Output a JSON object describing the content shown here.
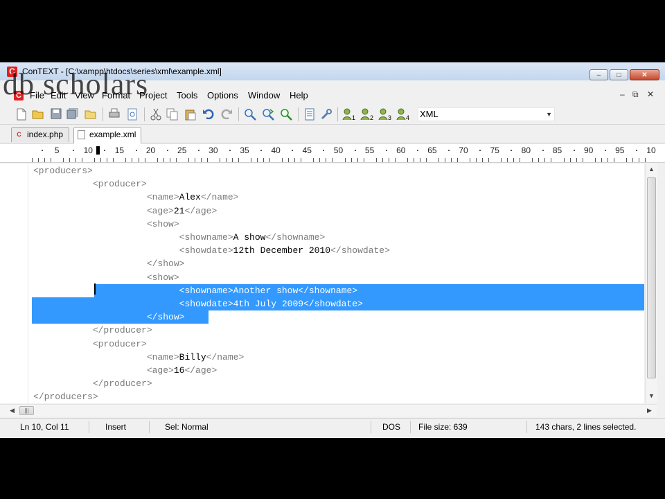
{
  "window": {
    "title": "ConTEXT - [C:\\xampp\\htdocs\\series\\xml\\example.xml]",
    "app_icon_letter": "C",
    "controls": {
      "minimize": "‒",
      "maximize": "□",
      "close": "✕"
    }
  },
  "watermark": "db scholars",
  "menu": {
    "items": [
      "File",
      "Edit",
      "View",
      "Format",
      "Project",
      "Tools",
      "Options",
      "Window",
      "Help"
    ],
    "mdi_controls": [
      "‒",
      "⧉",
      "✕"
    ]
  },
  "toolbar": {
    "icons": [
      "new-file-icon",
      "open-folder-icon",
      "save-icon",
      "save-all-icon",
      "open-file-icon",
      "print-icon",
      "print-preview-icon",
      "cut-icon",
      "copy-icon",
      "paste-icon",
      "undo-icon",
      "redo-icon",
      "find-icon",
      "find-next-icon",
      "replace-icon",
      "file-properties-icon",
      "tools-icon",
      "user-command-1-icon",
      "user-command-2-icon",
      "user-command-3-icon",
      "user-command-4-icon"
    ],
    "highlighter": {
      "selected": "XML"
    }
  },
  "tabs": [
    {
      "label": "index.php",
      "active": false
    },
    {
      "label": "example.xml",
      "active": true
    }
  ],
  "ruler": {
    "labels": [
      "5",
      "10",
      "15",
      "20",
      "25",
      "30",
      "35",
      "40",
      "45",
      "50",
      "55",
      "60",
      "65",
      "70",
      "75",
      "80",
      "85",
      "90",
      "95",
      "10"
    ]
  },
  "editor": {
    "selection_color": "#3399ff",
    "lines": [
      {
        "indent": 0,
        "parts": [
          [
            "t",
            "<producers>"
          ]
        ]
      },
      {
        "indent": 11,
        "parts": [
          [
            "t",
            "<producer>"
          ]
        ]
      },
      {
        "indent": 21,
        "parts": [
          [
            "t",
            "<name>"
          ],
          [
            "x",
            "Alex"
          ],
          [
            "t",
            "</name>"
          ]
        ]
      },
      {
        "indent": 21,
        "parts": [
          [
            "t",
            "<age>"
          ],
          [
            "x",
            "21"
          ],
          [
            "t",
            "</age>"
          ]
        ]
      },
      {
        "indent": 21,
        "parts": [
          [
            "t",
            "<show>"
          ]
        ]
      },
      {
        "indent": 27,
        "parts": [
          [
            "t",
            "<showname>"
          ],
          [
            "x",
            "A show"
          ],
          [
            "t",
            "</showname>"
          ]
        ]
      },
      {
        "indent": 27,
        "parts": [
          [
            "t",
            "<showdate>"
          ],
          [
            "x",
            "12th December 2010"
          ],
          [
            "t",
            "</showdate>"
          ]
        ]
      },
      {
        "indent": 21,
        "parts": [
          [
            "t",
            "</show>"
          ]
        ]
      },
      {
        "indent": 21,
        "parts": [
          [
            "t",
            "<show>"
          ]
        ]
      },
      {
        "indent": 27,
        "parts": [
          [
            "t",
            "<showname>"
          ],
          [
            "x",
            "Another show"
          ],
          [
            "t",
            "</showname>"
          ]
        ],
        "selected": "full"
      },
      {
        "indent": 27,
        "parts": [
          [
            "t",
            "<showdate>"
          ],
          [
            "x",
            "4th July 2009"
          ],
          [
            "t",
            "</showdate>"
          ]
        ],
        "selected": "full"
      },
      {
        "indent": 21,
        "parts": [
          [
            "t",
            "</show>"
          ]
        ],
        "selected": "partial"
      },
      {
        "indent": 11,
        "parts": [
          [
            "t",
            "</producer>"
          ]
        ]
      },
      {
        "indent": 11,
        "parts": [
          [
            "t",
            "<producer>"
          ]
        ]
      },
      {
        "indent": 21,
        "parts": [
          [
            "t",
            "<name>"
          ],
          [
            "x",
            "Billy"
          ],
          [
            "t",
            "</name>"
          ]
        ]
      },
      {
        "indent": 21,
        "parts": [
          [
            "t",
            "<age>"
          ],
          [
            "x",
            "16"
          ],
          [
            "t",
            "</age>"
          ]
        ]
      },
      {
        "indent": 11,
        "parts": [
          [
            "t",
            "</producer>"
          ]
        ]
      },
      {
        "indent": 0,
        "parts": [
          [
            "t",
            "</producers>"
          ]
        ]
      }
    ]
  },
  "statusbar": {
    "position": "Ln 10, Col 11",
    "insert_mode": "Insert",
    "selection_mode": "Sel: Normal",
    "line_endings": "DOS",
    "file_size": "File size: 639",
    "selection_info": "143 chars, 2 lines selected."
  }
}
